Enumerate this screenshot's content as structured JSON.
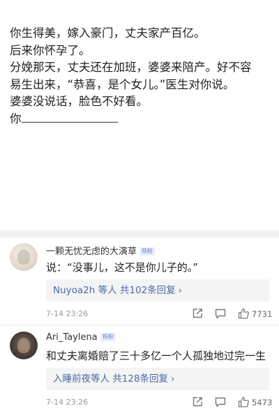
{
  "post": {
    "lines": [
      "你生得美，嫁入豪门，丈夫家产百亿。",
      "后来你怀孕了。",
      "分娩那天，丈夫还在加班，婆婆来陪产。好不容",
      "易生出来，“恭喜，是个女儿。”医生对你说。",
      "婆婆没说话，脸色不好看。",
      "你"
    ]
  },
  "comments": [
    {
      "username": "一颗无忧无虑的大演草",
      "badge": "铁粉",
      "text": "说：“没事儿，这不是你儿子的。”",
      "reply_summary": "Nuyoa2h 等人  共102条回复",
      "timestamp": "7-14 23:26",
      "likes": "7731"
    },
    {
      "username": "Ari_Taylena",
      "badge": "铁粉",
      "text": "和丈夫离婚赔了三十多亿一个人孤独地过完一生",
      "reply_summary": "入睡前夜等人  共128条回复",
      "timestamp": "7-14 23:26",
      "likes": "5473"
    }
  ],
  "icons": {
    "reply_chevron": "›",
    "share": "share-icon",
    "comment": "comment-icon",
    "like": "like-icon"
  },
  "colors": {
    "link": "#4b6aa8",
    "badge_bg": "#eaeefc",
    "badge_text": "#6b86c9",
    "meta": "#9a9a9a"
  }
}
